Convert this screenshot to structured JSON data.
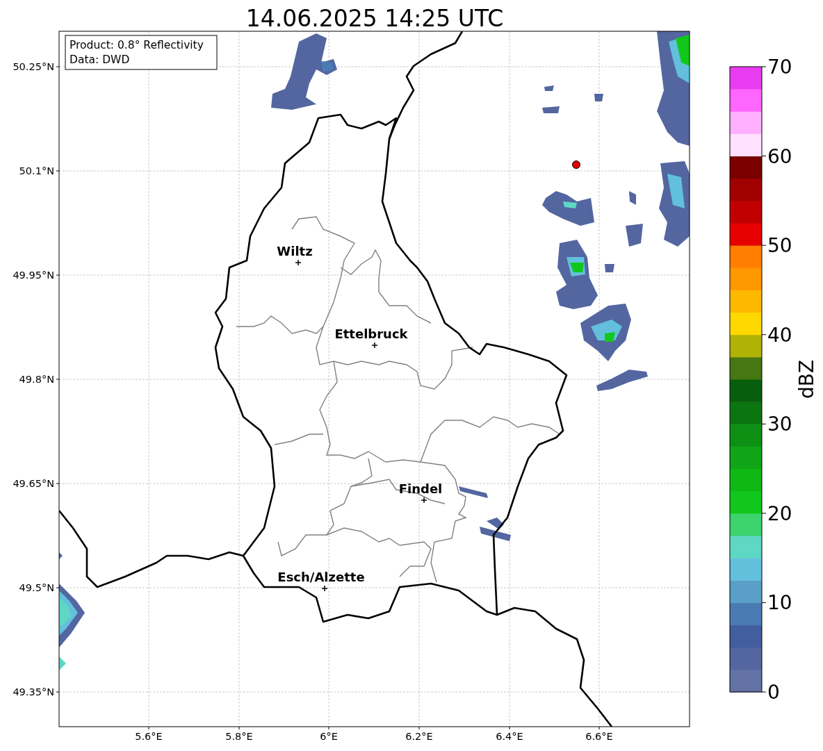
{
  "title": "14.06.2025 14:25 UTC",
  "info_box": [
    "Product: 0.8° Reflectivity",
    "Data: DWD"
  ],
  "x_ticks": [
    "5.6°E",
    "5.8°E",
    "6°E",
    "6.2°E",
    "6.4°E",
    "6.6°E"
  ],
  "y_ticks": [
    "50.25°N",
    "50.1°N",
    "49.95°N",
    "49.8°N",
    "49.65°N",
    "49.5°N",
    "49.35°N"
  ],
  "cities": [
    {
      "name": "Wiltz"
    },
    {
      "name": "Ettelbruck"
    },
    {
      "name": "Findel"
    },
    {
      "name": "Esch/Alzette"
    }
  ],
  "colorbar": {
    "label": "dBZ",
    "ticks": [
      "70",
      "60",
      "50",
      "40",
      "30",
      "20",
      "10",
      "0"
    ],
    "segments": [
      {
        "color": "#6473a6"
      },
      {
        "color": "#5366a0"
      },
      {
        "color": "#435e9f"
      },
      {
        "color": "#4a7bb3"
      },
      {
        "color": "#5a9fc8"
      },
      {
        "color": "#62c0dc"
      },
      {
        "color": "#5fd7c5"
      },
      {
        "color": "#3dd46e"
      },
      {
        "color": "#12c71c"
      },
      {
        "color": "#10b816"
      },
      {
        "color": "#10a516"
      },
      {
        "color": "#0d8f14"
      },
      {
        "color": "#0b7610"
      },
      {
        "color": "#075e0c"
      },
      {
        "color": "#467712"
      },
      {
        "color": "#b0b206"
      },
      {
        "color": "#ffd800"
      },
      {
        "color": "#ffb800"
      },
      {
        "color": "#ff9800"
      },
      {
        "color": "#ff7e00"
      },
      {
        "color": "#e60000"
      },
      {
        "color": "#c00000"
      },
      {
        "color": "#a00000"
      },
      {
        "color": "#7a0000"
      },
      {
        "color": "#ffe0ff"
      },
      {
        "color": "#ffb0ff"
      },
      {
        "color": "#ff66ff"
      },
      {
        "color": "#e83cf0"
      }
    ]
  }
}
